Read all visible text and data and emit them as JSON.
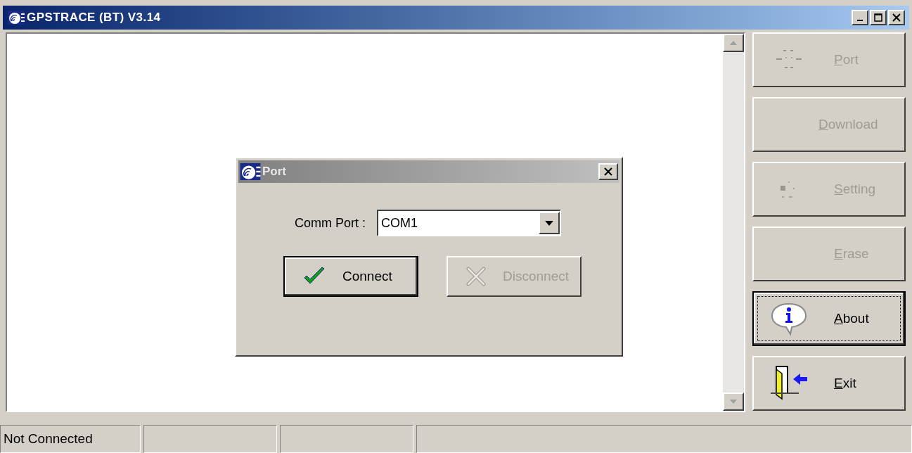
{
  "window": {
    "title": "GPSTRACE (BT) V3.14"
  },
  "side_buttons": [
    {
      "label": "Port",
      "disabled": true,
      "focused": false
    },
    {
      "label": "Download",
      "disabled": true,
      "focused": false
    },
    {
      "label": "Setting",
      "disabled": true,
      "focused": false
    },
    {
      "label": "Erase",
      "disabled": true,
      "focused": false
    },
    {
      "label": "About",
      "disabled": false,
      "focused": true
    },
    {
      "label": "Exit",
      "disabled": false,
      "focused": false
    }
  ],
  "dialog": {
    "title": "Port",
    "field_label": "Comm Port :",
    "port_value": "COM1",
    "buttons": [
      {
        "label": "Connect",
        "disabled": false
      },
      {
        "label": "Disconnect",
        "disabled": true
      }
    ]
  },
  "status_bar": {
    "text": "Not Connected"
  }
}
